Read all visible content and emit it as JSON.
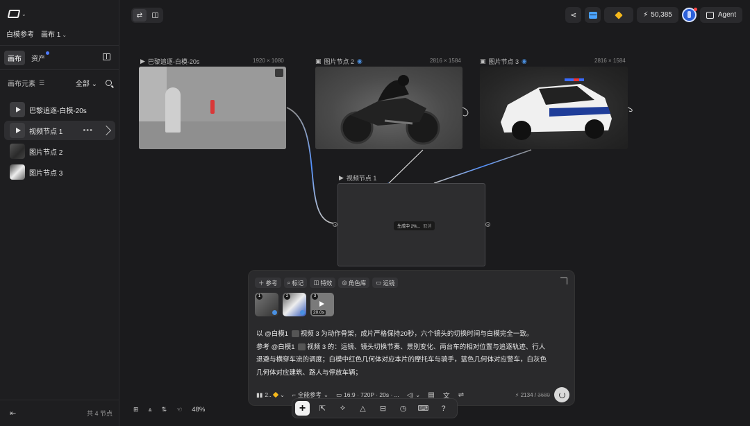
{
  "sidebar": {
    "crumb_project": "白模参考",
    "crumb_canvas": "画布 1",
    "tabs": [
      "画布",
      "资产"
    ],
    "elements_label": "画布元素",
    "filter_all": "全部",
    "nodes": [
      {
        "label": "巴黎追逐-白模-20s",
        "kind": "video"
      },
      {
        "label": "视频节点 1",
        "kind": "video"
      },
      {
        "label": "图片节点 2",
        "kind": "image"
      },
      {
        "label": "图片节点 3",
        "kind": "image"
      }
    ],
    "footer_count": "共 4 节点"
  },
  "topbar": {
    "credits": "50,385",
    "agent_label": "Agent"
  },
  "canvas": {
    "node_scene": {
      "title": "巴黎追逐-白模-20s",
      "size": "1920 × 1080"
    },
    "node_img2": {
      "title": "图片节点 2",
      "size": "2816 × 1584"
    },
    "node_img3": {
      "title": "图片节点 3",
      "size": "2816 × 1584"
    },
    "node_video": {
      "title": "视频节点 1",
      "status": "生成中 2%...",
      "cancel": "取消"
    },
    "zoom": "48%"
  },
  "prompt": {
    "chips": [
      "参考",
      "标记",
      "特效",
      "角色库",
      "运镜"
    ],
    "refs": [
      {
        "n": "1"
      },
      {
        "n": "2"
      },
      {
        "n": "3",
        "duration": "20.0s"
      }
    ],
    "line1_a": "以 @白模1",
    "line1_b": "视频 3",
    "line1_c": "为动作骨架，成片严格保持20秒，六个镜头的切换时间与白模完全一致。",
    "line2_a": "参考 @白模1",
    "line2_b": "视频 3",
    "line2_c": "的：运镜、镜头切换节奏、景别变化、两台车的相对位置与追逐轨迹、行人",
    "line3": "退避与横穿车流的调度；白模中红色几何体对应本片的摩托车与骑手，蓝色几何体对应警车，白灰色",
    "line4": "几何体对应建筑、路人与停放车辆；",
    "model_short": "2..",
    "ref_mode": "全能参考",
    "spec": "16:9 · 720P · 20s · ...",
    "count": "2134",
    "count_max": "3680"
  },
  "colors": {
    "accent": "#4f7cff",
    "gem": "#f5b81b",
    "background": "#1b1b1d"
  }
}
